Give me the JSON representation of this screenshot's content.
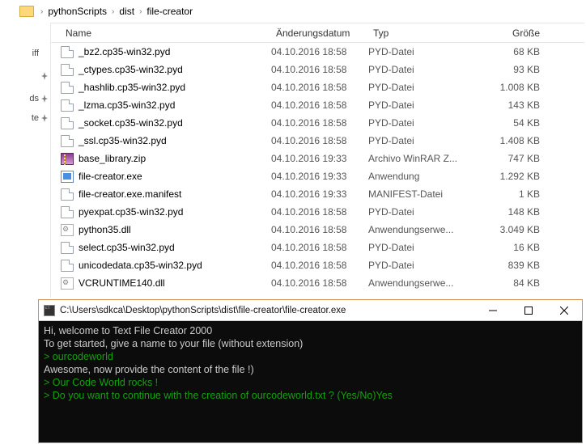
{
  "breadcrumb": {
    "seg1": "pythonScripts",
    "seg2": "dist",
    "seg3": "file-creator"
  },
  "leftnav": {
    "item1": "iff",
    "item2": "ds",
    "item3": "te"
  },
  "columns": {
    "name": "Name",
    "date": "Änderungsdatum",
    "type": "Typ",
    "size": "Größe"
  },
  "files": [
    {
      "name": "_bz2.cp35-win32.pyd",
      "date": "04.10.2016 18:58",
      "type": "PYD-Datei",
      "size": "68 KB",
      "icon": "generic"
    },
    {
      "name": "_ctypes.cp35-win32.pyd",
      "date": "04.10.2016 18:58",
      "type": "PYD-Datei",
      "size": "93 KB",
      "icon": "generic"
    },
    {
      "name": "_hashlib.cp35-win32.pyd",
      "date": "04.10.2016 18:58",
      "type": "PYD-Datei",
      "size": "1.008 KB",
      "icon": "generic"
    },
    {
      "name": "_lzma.cp35-win32.pyd",
      "date": "04.10.2016 18:58",
      "type": "PYD-Datei",
      "size": "143 KB",
      "icon": "generic"
    },
    {
      "name": "_socket.cp35-win32.pyd",
      "date": "04.10.2016 18:58",
      "type": "PYD-Datei",
      "size": "54 KB",
      "icon": "generic"
    },
    {
      "name": "_ssl.cp35-win32.pyd",
      "date": "04.10.2016 18:58",
      "type": "PYD-Datei",
      "size": "1.408 KB",
      "icon": "generic"
    },
    {
      "name": "base_library.zip",
      "date": "04.10.2016 19:33",
      "type": "Archivo WinRAR Z...",
      "size": "747 KB",
      "icon": "zip"
    },
    {
      "name": "file-creator.exe",
      "date": "04.10.2016 19:33",
      "type": "Anwendung",
      "size": "1.292 KB",
      "icon": "exe"
    },
    {
      "name": "file-creator.exe.manifest",
      "date": "04.10.2016 19:33",
      "type": "MANIFEST-Datei",
      "size": "1 KB",
      "icon": "generic"
    },
    {
      "name": "pyexpat.cp35-win32.pyd",
      "date": "04.10.2016 18:58",
      "type": "PYD-Datei",
      "size": "148 KB",
      "icon": "generic"
    },
    {
      "name": "python35.dll",
      "date": "04.10.2016 18:58",
      "type": "Anwendungserwe...",
      "size": "3.049 KB",
      "icon": "dll"
    },
    {
      "name": "select.cp35-win32.pyd",
      "date": "04.10.2016 18:58",
      "type": "PYD-Datei",
      "size": "16 KB",
      "icon": "generic"
    },
    {
      "name": "unicodedata.cp35-win32.pyd",
      "date": "04.10.2016 18:58",
      "type": "PYD-Datei",
      "size": "839 KB",
      "icon": "generic"
    },
    {
      "name": "VCRUNTIME140.dll",
      "date": "04.10.2016 18:58",
      "type": "Anwendungserwe...",
      "size": "84 KB",
      "icon": "dll"
    }
  ],
  "console": {
    "title": "C:\\Users\\sdkca\\Desktop\\pythonScripts\\dist\\file-creator\\file-creator.exe",
    "lines": [
      {
        "text": "Hi, welcome to Text File Creator 2000",
        "cls": ""
      },
      {
        "text": "To get started, give a name to your file (without extension)",
        "cls": ""
      },
      {
        "text": "> ourcodeworld",
        "cls": "green"
      },
      {
        "text": "Awesome, now provide the content of the file !)",
        "cls": ""
      },
      {
        "text": "> Our Code World rocks !",
        "cls": "green"
      },
      {
        "text": "> Do you want to continue with the creation of ourcodeworld.txt ? (Yes/No)Yes",
        "cls": "green"
      }
    ]
  }
}
